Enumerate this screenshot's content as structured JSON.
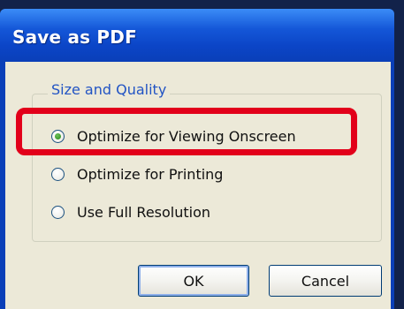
{
  "dialog": {
    "title": "Save as PDF"
  },
  "group": {
    "title": "Size and Quality",
    "options": [
      {
        "label": "Optimize for Viewing Onscreen",
        "selected": true
      },
      {
        "label": "Optimize for Printing",
        "selected": false
      },
      {
        "label": "Use Full Resolution",
        "selected": false
      }
    ]
  },
  "buttons": {
    "ok_label": "OK",
    "cancel_label": "Cancel"
  },
  "colors": {
    "titlebar": "#0a3fb8",
    "client": "#ece9d8",
    "group_title": "#2254c4",
    "highlight": "#e2001a"
  }
}
